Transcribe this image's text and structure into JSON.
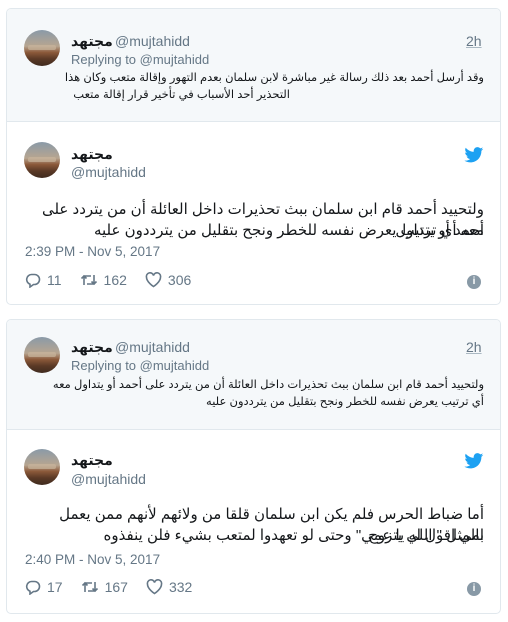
{
  "tweets": [
    {
      "quoted": {
        "name": "مجتهد",
        "handle": "@mujtahidd",
        "time": "2h",
        "replying_prefix": "Replying to ",
        "replying_handle": "@mujtahidd",
        "text_line1": "وقد أرسل أحمد بعد ذلك رسالة غير مباشرة لابن سلمان بعدم التهور وإقالة متعب وكان هذا",
        "text_line2": "التحذير أحد الأسباب في تأخير قرار إقالة متعب"
      },
      "main": {
        "name": "مجتهد",
        "handle": "@mujtahidd",
        "text_line1": "ولتحييد أحمد قام ابن سلمان ببث تحذيرات داخل العائلة أن من يتردد على أحمد أو يتداول",
        "text_line2": "معه أي ترتيب يعرض نفسه للخطر ونجح بتقليل من يترددون عليه",
        "timestamp": "2:39 PM - Nov 5, 2017",
        "replies": "11",
        "retweets": "162",
        "likes": "306"
      }
    },
    {
      "quoted": {
        "name": "مجتهد",
        "handle": "@mujtahidd",
        "time": "2h",
        "replying_prefix": "Replying to ",
        "replying_handle": "@mujtahidd",
        "text_line1": "ولتحييد أحمد قام ابن سلمان ببث تحذيرات داخل العائلة أن من يتردد على أحمد أو يتداول معه",
        "text_line2": "أي ترتيب يعرض نفسه للخطر ونجح بتقليل من يترددون عليه"
      },
      "main": {
        "name": "مجتهد",
        "handle": "@mujtahidd",
        "text_line1": "أما ضباط الحرس فلم يكن ابن سلمان قلقا من ولائهم لأنهم ممن يعمل بالمثل \" اللي يتزوج",
        "text_line2": "امي اقول له يا عمي\" وحتى لو تعهدوا لمتعب بشيء فلن ينفذوه",
        "timestamp": "2:40 PM - Nov 5, 2017",
        "replies": "17",
        "retweets": "167",
        "likes": "332"
      }
    }
  ],
  "colors": {
    "twitter_blue": "#1da1f2",
    "muted": "#657786",
    "border": "#e1e8ed",
    "reply_bg": "#f5f8fa"
  },
  "icons": [
    "twitter-bird-icon",
    "reply-icon",
    "retweet-icon",
    "like-icon",
    "info-icon"
  ]
}
